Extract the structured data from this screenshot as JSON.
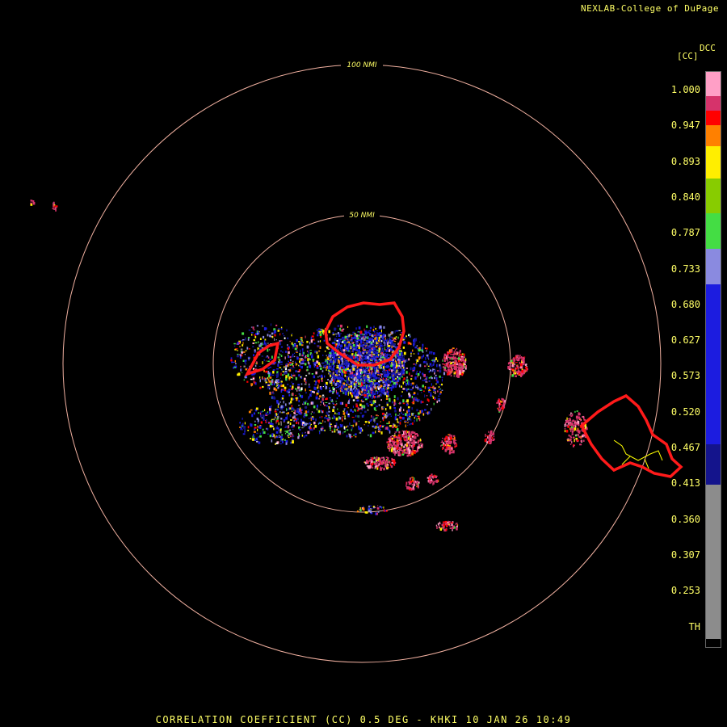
{
  "credit": "NEXLAB-College of DuPage",
  "footer": "CORRELATION COEFFICIENT (CC) 0.5 DEG - KHKI 10 JAN 26 10:49",
  "legend": {
    "code": "DCC",
    "unit": "[CC]",
    "ticks": [
      "1.000",
      "0.947",
      "0.893",
      "0.840",
      "0.787",
      "0.733",
      "0.680",
      "0.627",
      "0.573",
      "0.520",
      "0.467",
      "0.413",
      "0.360",
      "0.307",
      "0.253",
      "TH"
    ],
    "colors": {
      "pink": "#ff9fc6",
      "magenta": "#d6336b",
      "red": "#ff0000",
      "orange": "#ff8000",
      "yellow": "#ffee00",
      "lime": "#88cc00",
      "green": "#44dd44",
      "lavender": "#8a8ae0",
      "blue": "#1c1ce0",
      "navy": "#14148c",
      "gray": "#8c8c8c"
    }
  },
  "rings": [
    {
      "label": "50 NMI"
    },
    {
      "label": "100 NMI"
    }
  ],
  "colors": {
    "ring": "#f0b0a0",
    "outline": "#ff1a1a",
    "ring_label": "#ffff66",
    "coast": "#ffff00"
  }
}
